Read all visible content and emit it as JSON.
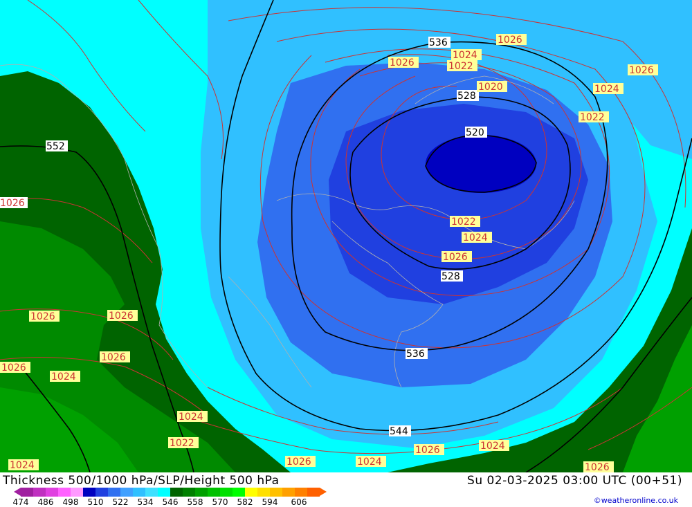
{
  "header": {
    "title": "Thickness 500/1000 hPa/SLP/Height 500 hPa",
    "datetime": "Su 02-03-2025 03:00 UTC (00+51)",
    "credit": "©weatheronline.co.uk"
  },
  "legend": {
    "ticks": [
      "474",
      "486",
      "498",
      "510",
      "522",
      "534",
      "546",
      "558",
      "570",
      "582",
      "594",
      "606"
    ],
    "colors": [
      "#a020a0",
      "#c030c0",
      "#e040e0",
      "#ff60ff",
      "#ff99ff",
      "#0000c0",
      "#2040e0",
      "#3070f0",
      "#40a0ff",
      "#30c0ff",
      "#40e0ff",
      "#00ffff",
      "#006400",
      "#008000",
      "#00a000",
      "#00c000",
      "#00e000",
      "#00ff00",
      "#ffff00",
      "#ffe000",
      "#ffc000",
      "#ffa000",
      "#ff8000",
      "#ff6000"
    ]
  },
  "colors": {
    "land_green_dark": "#006400",
    "land_green_mid": "#008a00",
    "thickness_cyan": "#00ffff",
    "thickness_light_blue": "#30c0ff",
    "thickness_blue": "#3070f0",
    "thickness_deep_blue": "#2040e0",
    "thickness_core": "#0000c0",
    "slp_isobar": "#cc3333",
    "height_contour": "#000000"
  },
  "contours": {
    "height_labels": [
      "536",
      "528",
      "520",
      "528",
      "536",
      "544",
      "552"
    ],
    "slp_labels": [
      "1026",
      "1024",
      "1022",
      "1026",
      "1020",
      "1026",
      "1024",
      "1022",
      "1022",
      "1024",
      "1026",
      "1026",
      "1026",
      "1026",
      "1026",
      "1024",
      "1026",
      "1024",
      "1022",
      "1024",
      "1026",
      "1024",
      "1026",
      "1024",
      "1026"
    ]
  }
}
